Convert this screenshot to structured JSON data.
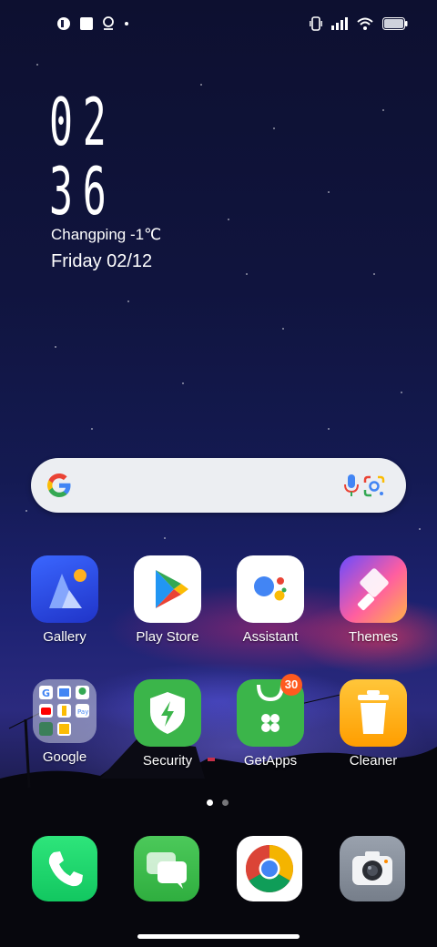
{
  "status_bar": {
    "left_icons": [
      "app-badge-icon",
      "square-notification-icon",
      "location-pin-icon",
      "dot-indicator-icon"
    ],
    "right_icons": [
      "vibrate-icon",
      "signal-bars-icon",
      "wifi-icon",
      "battery-icon"
    ]
  },
  "clock": {
    "hours": "02",
    "minutes": "36",
    "location": "Changping -1℃",
    "date": "Friday  02/12"
  },
  "search": {
    "placeholder": "",
    "icons": [
      "google-g-icon",
      "microphone-icon",
      "google-lens-icon"
    ]
  },
  "apps": [
    {
      "label": "Gallery",
      "icon": "gallery-icon"
    },
    {
      "label": "Play Store",
      "icon": "play-store-icon"
    },
    {
      "label": "Assistant",
      "icon": "assistant-icon"
    },
    {
      "label": "Themes",
      "icon": "themes-icon"
    },
    {
      "label": "Google",
      "icon": "google-folder-icon"
    },
    {
      "label": "Security",
      "icon": "security-shield-icon"
    },
    {
      "label": "GetApps",
      "icon": "getapps-bag-icon",
      "badge": "30"
    },
    {
      "label": "Cleaner",
      "icon": "cleaner-trash-icon"
    }
  ],
  "page_indicator": {
    "pages": 2,
    "current": 1
  },
  "dock": [
    {
      "icon": "phone-icon"
    },
    {
      "icon": "messages-icon"
    },
    {
      "icon": "chrome-icon"
    },
    {
      "icon": "camera-icon"
    }
  ],
  "colors": {
    "security": "#3bb54a",
    "getapps": "#3bb54a",
    "badge": "#ff5a1f",
    "gallery": "#2a4ee8",
    "cleaner": "#ffb400",
    "phone": "#1ed760"
  }
}
